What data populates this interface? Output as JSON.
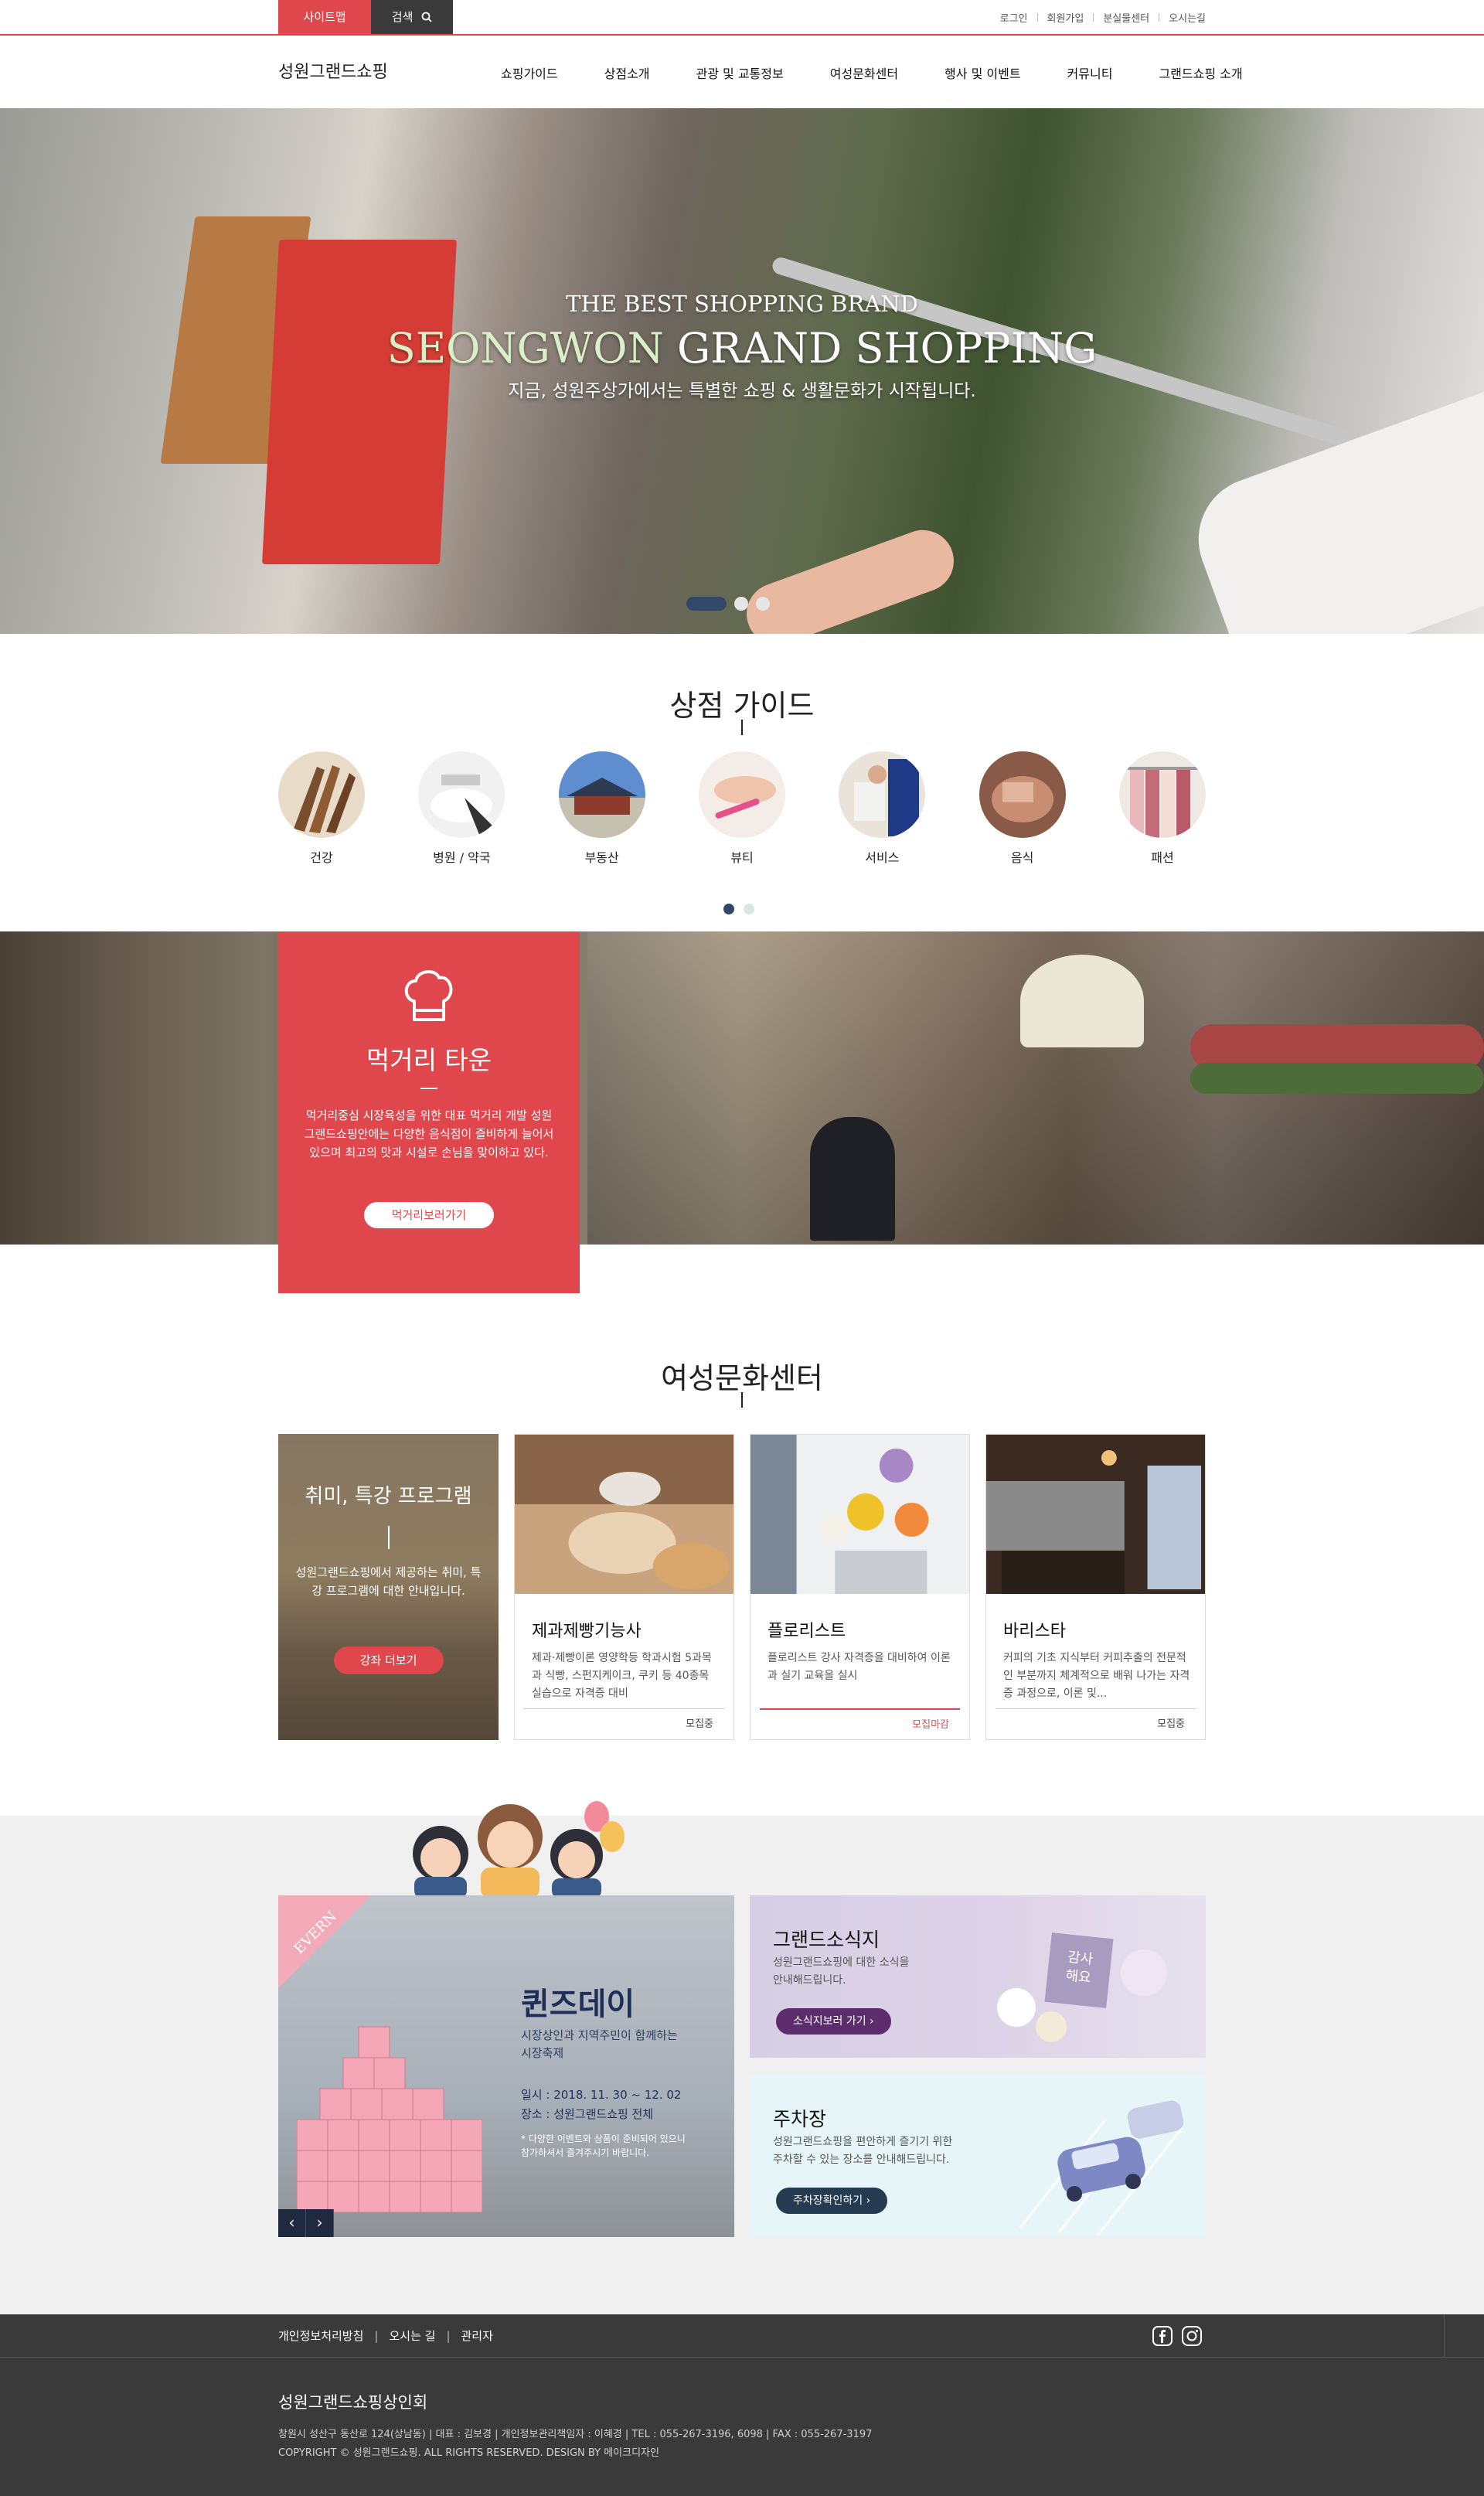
{
  "topbar": {
    "sitemap": "사이트맵",
    "search": "검색",
    "util": [
      "로그인",
      "회원가입",
      "분실물센터",
      "오시는길"
    ]
  },
  "nav": {
    "logo": "성원그랜드쇼핑",
    "menu": [
      "쇼핑가이드",
      "상점소개",
      "관광 및 교통정보",
      "여성문화센터",
      "행사 및 이벤트",
      "커뮤니티",
      "그랜드쇼핑 소개"
    ]
  },
  "hero": {
    "line1": "THE BEST SHOPPING BRAND",
    "line2a": "SEONGWON",
    "line2b": " GRAND SHOPPING",
    "line3": "지금, 성원주상가에서는 특별한 쇼핑 & 생활문화가 시작됩니다."
  },
  "guide": {
    "title": "상점 가이드",
    "items": [
      "건강",
      "병원 / 약국",
      "부동산",
      "뷰티",
      "서비스",
      "음식",
      "패션"
    ]
  },
  "food": {
    "title": "먹거리 타운",
    "desc": "먹거리중심 시장육성을 위한 대표 먹거리 개발 성원그랜드쇼핑안에는 다양한 음식점이 즐비하게 늘어서 있으며 최고의 맛과 시설로 손님을 맞이하고 있다.",
    "button": "먹거리보러가기"
  },
  "women": {
    "title": "여성문화센터",
    "intro_title": "취미, 특강 프로그램",
    "intro_desc": "성원그랜드쇼핑에서 제공하는 취미, 특강 프로그램에 대한 안내입니다.",
    "intro_button": "강좌 더보기",
    "cards": [
      {
        "title": "제과제빵기능사",
        "desc": "제과·제빵이론 영양학등 학과시험 5과목과 식빵, 스펀지케이크, 쿠키 등 40종목 실습으로 자격증 대비",
        "status": "모집중"
      },
      {
        "title": "플로리스트",
        "desc": "플로리스트 강사 자격증을 대비하여 이론과 실기 교육을 실시",
        "status": "모집마감"
      },
      {
        "title": "바리스타",
        "desc": "커피의 기초 지식부터 커피추출의 전문적인 부분까지 체계적으로 배워 나가는 자격증 과정으로, 이론 및...",
        "status": "모집중"
      }
    ]
  },
  "events": {
    "badge": "EVERN",
    "queen_title": "퀸즈데이",
    "queen_sub": "시장상인과 지역주민이 함께하는\n시장축제",
    "queen_date": "일시 : 2018. 11. 30 ~ 12. 02",
    "queen_place": "장소 : 성원그랜드쇼핑 전체",
    "queen_note": "* 다양한 이벤트와 상품이 준비되어 있으니\n  참가하셔서 즐겨주시기 바랍니다.",
    "prev": "‹",
    "next": "›",
    "news_title": "그랜드소식지",
    "news_desc": "성원그랜드쇼핑에 대한 소식을\n안내해드립니다.",
    "news_button": "소식지보러 가기  ›",
    "news_card": "감사\n해요",
    "park_title": "주차장",
    "park_desc": "성원그랜드쇼핑을 편안하게 즐기기 위한\n주차할 수 있는 장소를 안내해드립니다.",
    "park_button": "주차장확인하기  ›"
  },
  "footer": {
    "links": [
      "개인정보처리방침",
      "오시는 길",
      "관리자"
    ],
    "org": "성원그랜드쇼핑상인회",
    "address": "창원시 성산구 동산로 124(상남동) | 대표 : 김보경  |  개인정보관리책임자 : 이혜경  |  TEL : 055-267-3196, 6098  |  FAX : 055-267-3197",
    "copyright": "COPYRIGHT © 성원그랜드쇼핑. ALL RIGHTS RESERVED. DESIGN BY 메이크디자인"
  },
  "colors": {
    "accent": "#e0474c",
    "navy": "#31486b",
    "dark": "#3a3a3a"
  }
}
